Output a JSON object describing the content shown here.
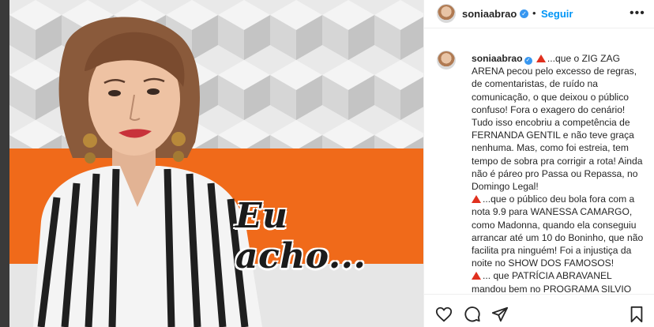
{
  "post": {
    "image_overlay_text": "Eu acho...",
    "colors": {
      "banner": "#f06a1a",
      "link": "#0095f6",
      "verified": "#3897f0",
      "warning": "#e0301e"
    }
  },
  "header": {
    "username": "soniaabrao",
    "separator": "•",
    "follow_label": "Seguir",
    "more_icon": "more-horizontal-icon"
  },
  "caption": {
    "username": "soniaabrao",
    "segments": [
      "...que o ZIG ZAG ARENA pecou pelo excesso de regras, de comentaristas, de ruído na comunicação, o que deixou o público confuso! Fora o exagero do cenário! Tudo isso encobriu a competência de FERNANDA GENTIL e não teve graça nenhuma. Mas, como foi estreia, tem tempo de sobra pra corrigir a rota! Ainda não é páreo pro Passa ou Repassa, no Domingo Legal!",
      "...que o público deu bola fora com a nota 9.9 para WANESSA CAMARGO, como Madonna, quando ela conseguiu arrancar até um 10 do Boninho, que não facilita pra ninguém! Foi a injustiça da noite no SHOW DOS FAMOSOS!",
      "... que PATRÍCIA ABRAVANEL mandou bem no PROGRAMA SILVIO SANTOS, espontânea e descontraída, apesar de todas as críticas que tem recebido..."
    ]
  },
  "actions": {
    "icons": [
      "heart-icon",
      "comment-icon",
      "share-icon",
      "bookmark-icon"
    ]
  }
}
